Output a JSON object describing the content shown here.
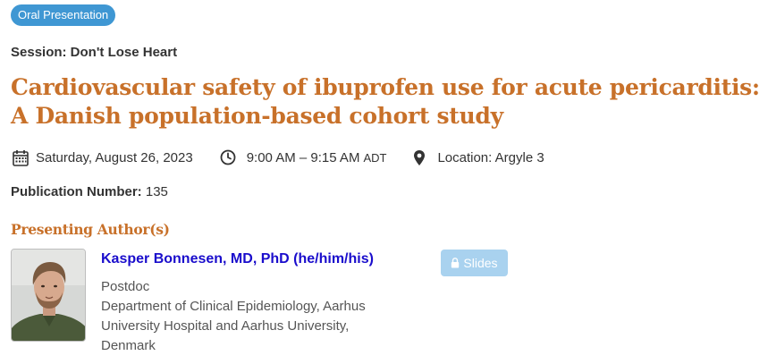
{
  "badge": {
    "label": "Oral Presentation"
  },
  "session": {
    "text": "Session: Don't Lose Heart"
  },
  "title": "Cardiovascular safety of ibuprofen use for acute pericarditis: A Danish population-based cohort study",
  "meta": {
    "date": "Saturday, August 26, 2023",
    "time": "9:00 AM – 9:15 AM",
    "timezone": "ADT",
    "location": "Location: Argyle 3"
  },
  "publication": {
    "label": "Publication Number:",
    "value": "135"
  },
  "presenting_heading": "Presenting Author(s)",
  "author": {
    "name": "Kasper Bonnesen, MD, PhD (he/him/his)",
    "role": "Postdoc",
    "affiliation": "Department of Clinical Epidemiology, Aarhus University Hospital and Aarhus University, Denmark"
  },
  "slides_button": {
    "label": "Slides"
  },
  "icons": [
    "calendar-icon",
    "clock-icon",
    "map-pin-icon",
    "lock-icon"
  ],
  "colors": {
    "accent": "#c8712a",
    "badge": "#3f97d3",
    "link": "#1a0dcc",
    "slides": "#a9d2ef"
  }
}
